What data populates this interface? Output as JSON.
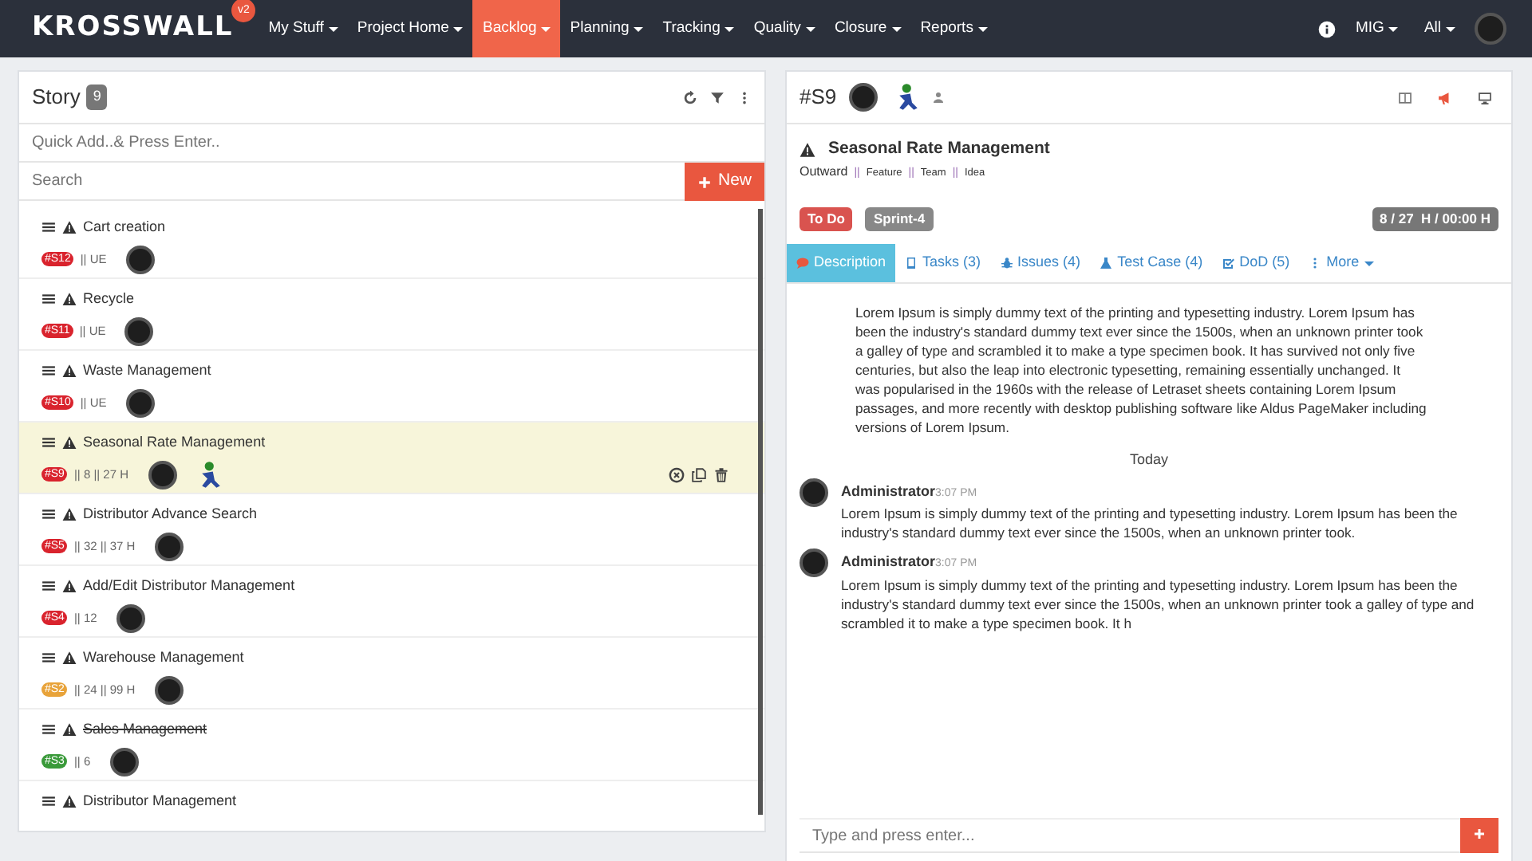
{
  "navbar": {
    "logo": "KROSSWALL",
    "version": "v2",
    "menus": [
      {
        "label": "My Stuff",
        "selected": false
      },
      {
        "label": "Project Home",
        "selected": false
      },
      {
        "label": "Backlog",
        "selected": true
      },
      {
        "label": "Planning",
        "selected": false
      },
      {
        "label": "Tracking",
        "selected": false
      },
      {
        "label": "Quality",
        "selected": false
      },
      {
        "label": "Closure",
        "selected": false
      },
      {
        "label": "Reports",
        "selected": false
      }
    ],
    "user": "MIG",
    "scope": "All"
  },
  "story_panel": {
    "title": "Story",
    "count": "9",
    "quick_add": {
      "placeholder": "Quick Add..& Press Enter.."
    },
    "search": {
      "placeholder": "Search"
    },
    "new_button": "New",
    "stories": [
      {
        "title": "Cart creation",
        "id": "#S12",
        "color": "#d9232d",
        "meta": "|| UE",
        "done": false,
        "selected": false,
        "avatars": [
          {
            "kind": "photo"
          }
        ]
      },
      {
        "title": "Recycle",
        "id": "#S11",
        "color": "#d9232d",
        "meta": "|| UE",
        "done": false,
        "selected": false,
        "avatars": [
          {
            "kind": "photo"
          }
        ]
      },
      {
        "title": "Waste Management",
        "id": "#S10",
        "color": "#d9232d",
        "meta": "|| UE",
        "done": false,
        "selected": false,
        "avatars": [
          {
            "kind": "photo"
          }
        ]
      },
      {
        "title": "Seasonal Rate Management",
        "id": "#S9",
        "color": "#d9232d",
        "meta": "|| 8 || 27 H",
        "done": false,
        "selected": true,
        "avatars": [
          {
            "kind": "photo"
          },
          {
            "kind": "figure"
          }
        ]
      },
      {
        "title": "Distributor Advance Search",
        "id": "#S5",
        "color": "#d9232d",
        "meta": "|| 32 || 37 H",
        "done": false,
        "selected": false,
        "avatars": [
          {
            "kind": "photo"
          }
        ]
      },
      {
        "title": "Add/Edit Distributor Management",
        "id": "#S4",
        "color": "#d9232d",
        "meta": "|| 12",
        "done": false,
        "selected": false,
        "avatars": [
          {
            "kind": "photo"
          }
        ]
      },
      {
        "title": "Warehouse Management",
        "id": "#S2",
        "color": "#e8a33a",
        "meta": "|| 24 || 99 H",
        "done": false,
        "selected": false,
        "avatars": [
          {
            "kind": "photo"
          }
        ]
      },
      {
        "title": "Sales Management",
        "id": "#S3",
        "color": "#3a9a3a",
        "meta": "|| 6",
        "done": true,
        "selected": false,
        "avatars": [
          {
            "kind": "photo"
          }
        ]
      },
      {
        "title": "Distributor Management",
        "done": false,
        "selected": false
      }
    ]
  },
  "detail_panel": {
    "id": "#S9",
    "title": "Seasonal Rate Management",
    "type": "Outward",
    "separator": "||",
    "tags": [
      "Feature",
      "Team",
      "Idea"
    ],
    "status": "To Do",
    "sprint": "Sprint-4",
    "hours": "8 / 27  H / 00:00 H",
    "tabs": [
      {
        "label": "Description",
        "selected": true
      },
      {
        "label": "Tasks (3)",
        "selected": false
      },
      {
        "label": "Issues (4)",
        "selected": false
      },
      {
        "label": "Test Case (4)",
        "selected": false
      },
      {
        "label": "DoD (5)",
        "selected": false
      },
      {
        "label": "More",
        "selected": false
      }
    ],
    "description": "Lorem Ipsum is simply dummy text of the printing and typesetting industry. Lorem Ipsum has been the industry's standard dummy text ever since the 1500s, when an unknown printer took a galley of type and scrambled it to make a type specimen book. It has survived not only five centuries, but also the leap into electronic typesetting, remaining essentially unchanged. It was popularised in the 1960s with the release of Letraset sheets containing Lorem Ipsum passages, and more recently with desktop publishing software like Aldus PageMaker including versions of Lorem Ipsum.",
    "day": "Today",
    "comments": [
      {
        "author": "Administrator",
        "time": "3:07 PM",
        "text": "Lorem Ipsum is simply dummy text of the printing and typesetting industry. Lorem Ipsum has been the industry's standard dummy text ever since the 1500s, when an unknown printer took."
      },
      {
        "author": "Administrator",
        "time": "3:07 PM",
        "text": "Lorem Ipsum is simply dummy text of the printing and typesetting industry. Lorem Ipsum has been the industry's standard dummy text ever since the 1500s, when an unknown printer took a galley of type and scrambled it to make a type specimen book. It h"
      }
    ],
    "comment_input": {
      "placeholder": "Type and press enter..."
    }
  }
}
